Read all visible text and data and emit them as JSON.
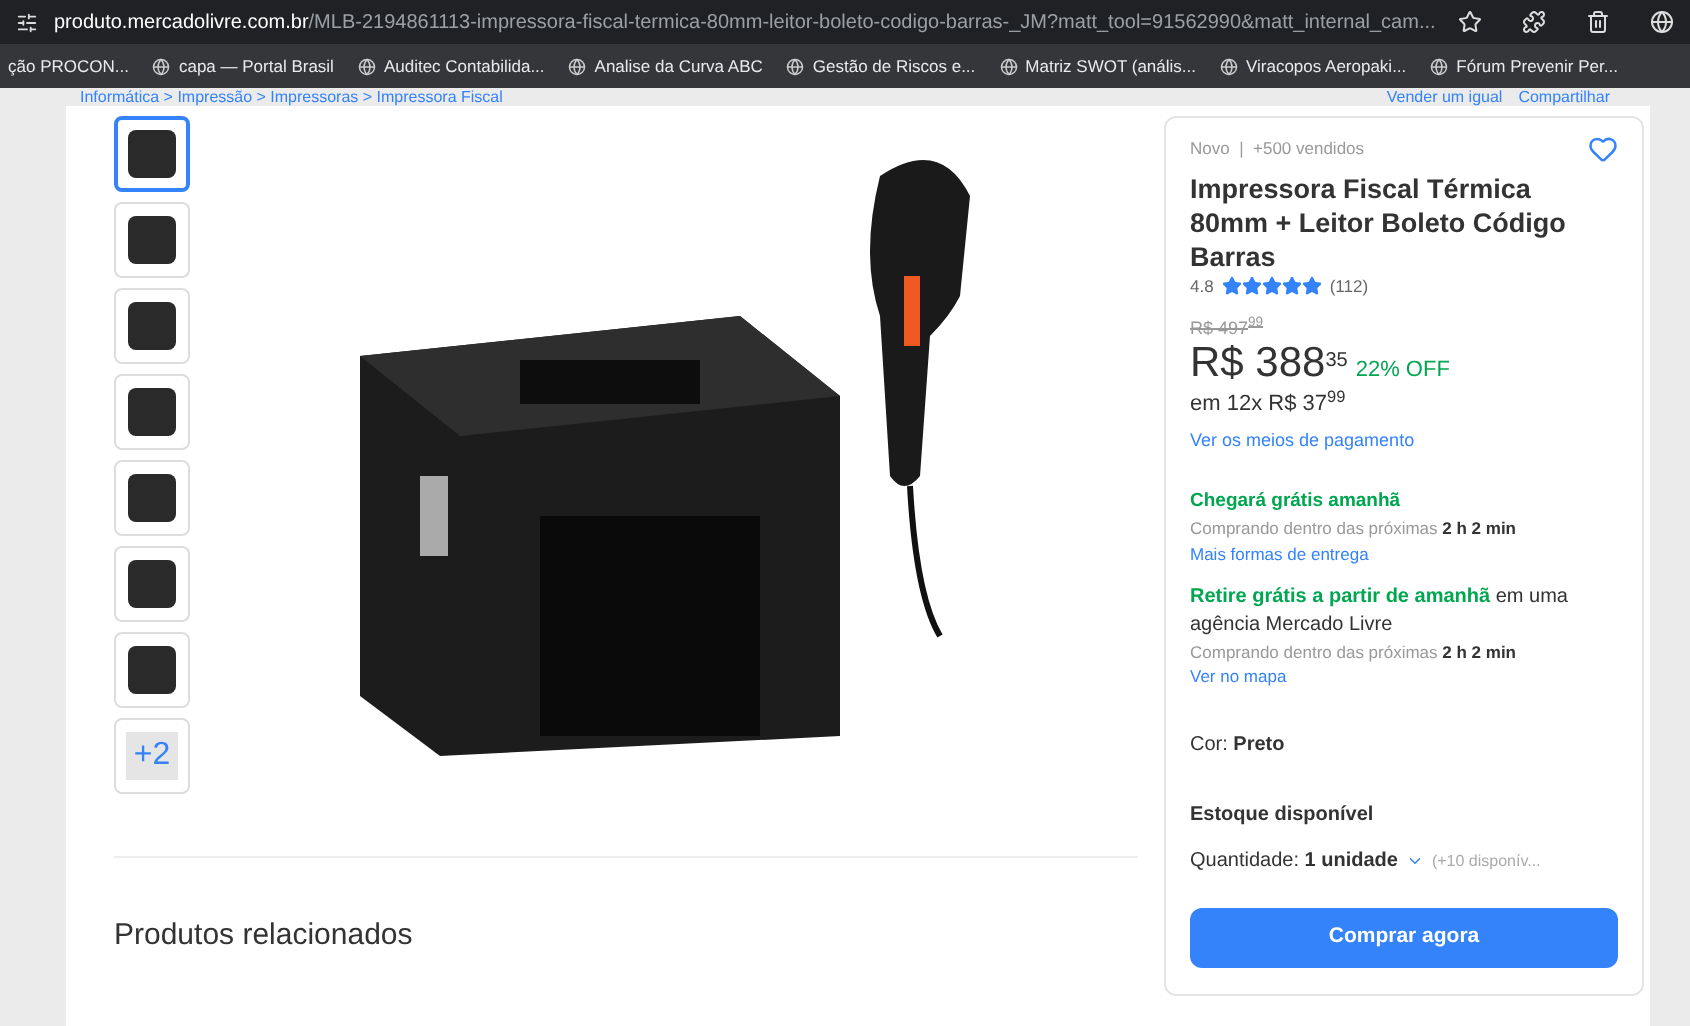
{
  "browser": {
    "url_domain": "produto.mercadolivre.com.br",
    "url_path": "/MLB-2194861113-impressora-fiscal-termica-80mm-leitor-boleto-codigo-barras-_JM?matt_tool=91562990&matt_internal_cam..."
  },
  "bookmarks": [
    "ção PROCON...",
    "capa — Portal Brasil",
    "Auditec Contabilida...",
    "Analise da Curva ABC",
    "Gestão de Riscos e...",
    "Matriz SWOT (anális...",
    "Viracopos Aeropaki...",
    "Fórum Prevenir Per..."
  ],
  "breadcrumb": "Informática > Impressão > Impressoras > Impressora Fiscal",
  "top_links": [
    "Vender um igual",
    "Compartilhar"
  ],
  "thumbnails": [
    {
      "selected": true
    },
    {
      "selected": false
    },
    {
      "selected": false
    },
    {
      "selected": false
    },
    {
      "selected": false
    },
    {
      "selected": false
    },
    {
      "selected": false
    },
    {
      "selected": false,
      "more": "+2"
    }
  ],
  "product": {
    "condition": "Novo  |  +500 vendidos",
    "favorite": false,
    "title": "Impressora Fiscal Térmica 80mm + Leitor Boleto Código Barras",
    "rating": "4.8",
    "stars": 5,
    "reviews": "(112)",
    "old_price": "R$ 497$^{99}$",
    "price": "R$ 388$^{35}$",
    "discount": "22% OFF",
    "installments": "em 12x R$ 37$^{99}$",
    "payment_link": "Ver os meios de pagamento",
    "shipping_title": "Chegará grátis amanhã",
    "shipping_note": "Comprando dentro das próximas **2 h 2 min**",
    "shipping_link": "Mais formas de entrega",
    "pickup": "**Retire grátis a partir de amanhã** em uma agência Mercado Livre",
    "pickup_note": "Comprando dentro das próximas **2 h 2 min**",
    "pickup_link": "Ver no mapa",
    "color_option": "Cor: **Preto**",
    "stock": "Estoque disponível",
    "quantity": "Quantidade: **1 unidade**",
    "available": "(+10 disponív...",
    "buy": "Comprar agora"
  },
  "related": {
    "title": "Produtos relacionados"
  }
}
